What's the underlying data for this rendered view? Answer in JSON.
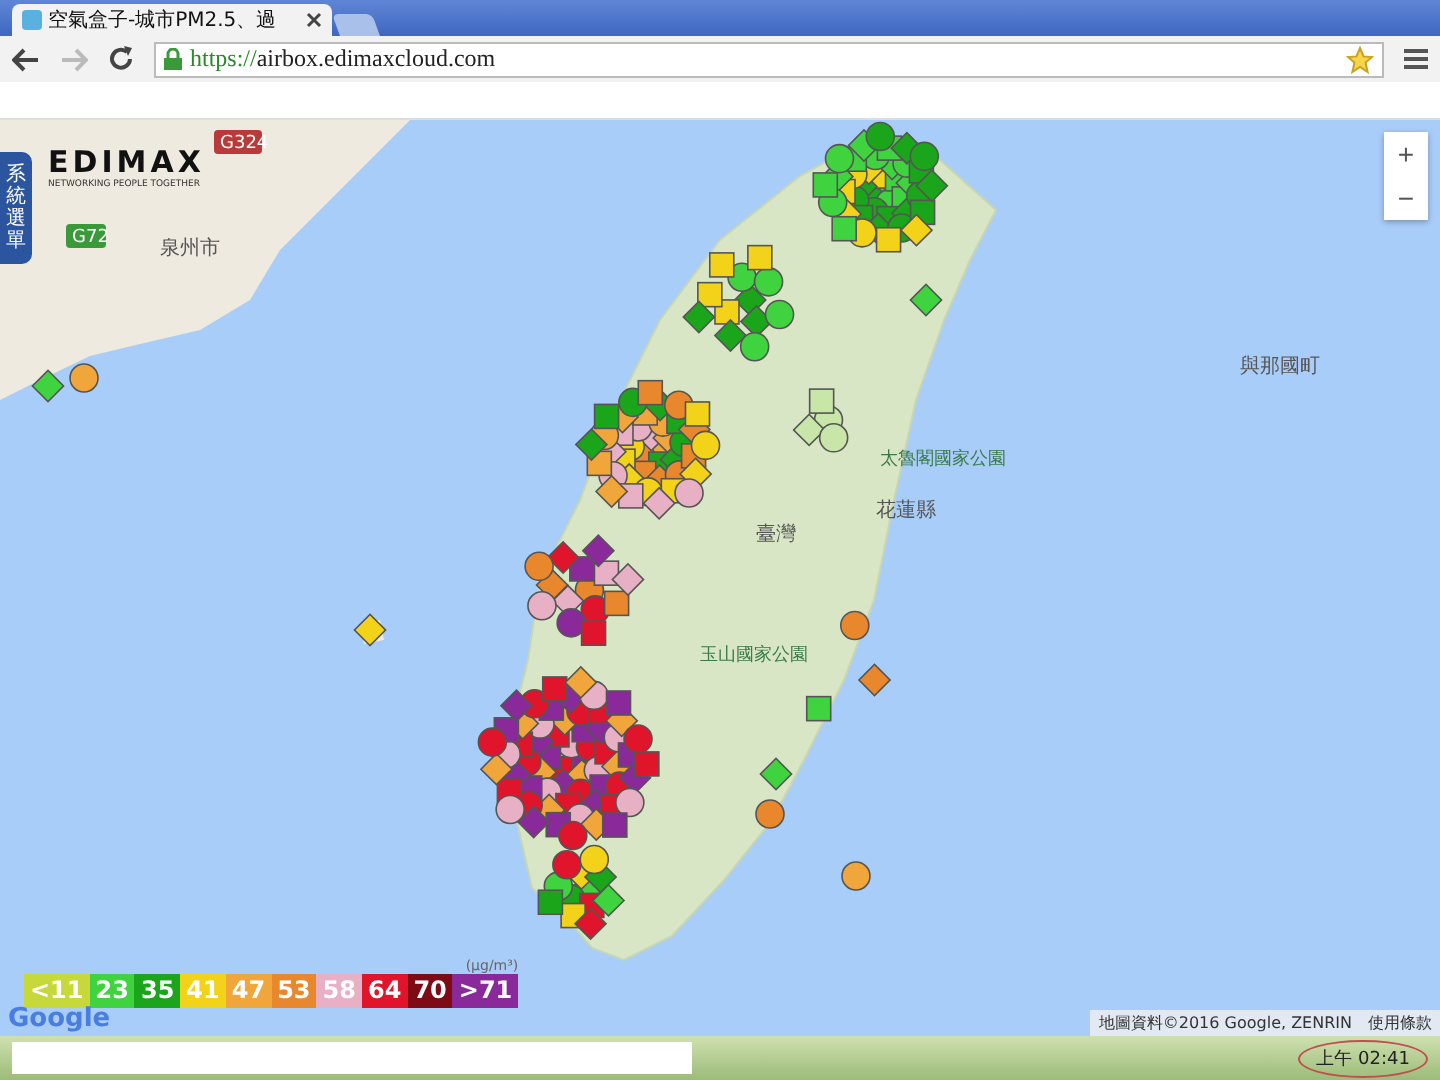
{
  "browser": {
    "tab_title": "空氣盒子-城市PM2.5、過",
    "url_scheme": "https://",
    "url_rest": "airbox.edimaxcloud.com"
  },
  "logo": {
    "name": "EDIMAX",
    "tagline": "NETWORKING PEOPLE TOGETHER"
  },
  "side_menu": {
    "label": "系統選單"
  },
  "map_labels": [
    {
      "text": "泉州市",
      "kind": "city"
    },
    {
      "text": "G324",
      "kind": "road"
    },
    {
      "text": "G72",
      "kind": "road"
    },
    {
      "text": "與那國町",
      "kind": "city"
    },
    {
      "text": "太魯閣國家公園",
      "kind": "park"
    },
    {
      "text": "花蓮縣",
      "kind": "city"
    },
    {
      "text": "臺灣",
      "kind": "city"
    },
    {
      "text": "玉山國家公園",
      "kind": "park"
    }
  ],
  "zoom": {
    "in": "+",
    "out": "−"
  },
  "legend": {
    "unit": "(μg/m³)",
    "items": [
      {
        "label": "<11",
        "color": "#c6d83a"
      },
      {
        "label": "23",
        "color": "#3fd43f"
      },
      {
        "label": "35",
        "color": "#1aa51a"
      },
      {
        "label": "41",
        "color": "#f2d31a"
      },
      {
        "label": "47",
        "color": "#f0a63a"
      },
      {
        "label": "53",
        "color": "#e8872c"
      },
      {
        "label": "58",
        "color": "#e8b0c4"
      },
      {
        "label": "64",
        "color": "#e0142a"
      },
      {
        "label": "70",
        "color": "#7d0a14"
      },
      {
        "label": ">71",
        "color": "#8a2a9a"
      }
    ]
  },
  "google": "Google",
  "attribution": "地圖資料©2016 Google, ZENRIN",
  "terms": "使用條款",
  "taskbar": {
    "time": "上午 02:41"
  }
}
